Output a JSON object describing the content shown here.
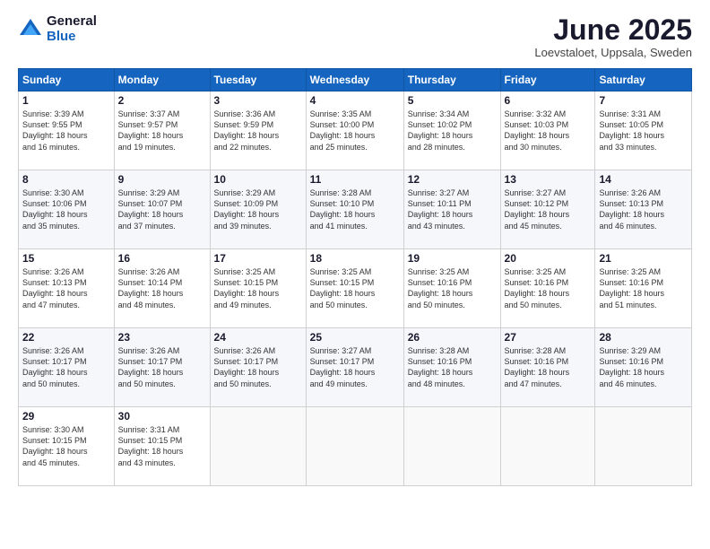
{
  "logo": {
    "general": "General",
    "blue": "Blue"
  },
  "header": {
    "title": "June 2025",
    "subtitle": "Loevstaloet, Uppsala, Sweden"
  },
  "weekdays": [
    "Sunday",
    "Monday",
    "Tuesday",
    "Wednesday",
    "Thursday",
    "Friday",
    "Saturday"
  ],
  "weeks": [
    [
      {
        "day": "1",
        "sunrise": "3:39 AM",
        "sunset": "9:55 PM",
        "daylight": "18 hours and 16 minutes."
      },
      {
        "day": "2",
        "sunrise": "3:37 AM",
        "sunset": "9:57 PM",
        "daylight": "18 hours and 19 minutes."
      },
      {
        "day": "3",
        "sunrise": "3:36 AM",
        "sunset": "9:59 PM",
        "daylight": "18 hours and 22 minutes."
      },
      {
        "day": "4",
        "sunrise": "3:35 AM",
        "sunset": "10:00 PM",
        "daylight": "18 hours and 25 minutes."
      },
      {
        "day": "5",
        "sunrise": "3:34 AM",
        "sunset": "10:02 PM",
        "daylight": "18 hours and 28 minutes."
      },
      {
        "day": "6",
        "sunrise": "3:32 AM",
        "sunset": "10:03 PM",
        "daylight": "18 hours and 30 minutes."
      },
      {
        "day": "7",
        "sunrise": "3:31 AM",
        "sunset": "10:05 PM",
        "daylight": "18 hours and 33 minutes."
      }
    ],
    [
      {
        "day": "8",
        "sunrise": "3:30 AM",
        "sunset": "10:06 PM",
        "daylight": "18 hours and 35 minutes."
      },
      {
        "day": "9",
        "sunrise": "3:29 AM",
        "sunset": "10:07 PM",
        "daylight": "18 hours and 37 minutes."
      },
      {
        "day": "10",
        "sunrise": "3:29 AM",
        "sunset": "10:09 PM",
        "daylight": "18 hours and 39 minutes."
      },
      {
        "day": "11",
        "sunrise": "3:28 AM",
        "sunset": "10:10 PM",
        "daylight": "18 hours and 41 minutes."
      },
      {
        "day": "12",
        "sunrise": "3:27 AM",
        "sunset": "10:11 PM",
        "daylight": "18 hours and 43 minutes."
      },
      {
        "day": "13",
        "sunrise": "3:27 AM",
        "sunset": "10:12 PM",
        "daylight": "18 hours and 45 minutes."
      },
      {
        "day": "14",
        "sunrise": "3:26 AM",
        "sunset": "10:13 PM",
        "daylight": "18 hours and 46 minutes."
      }
    ],
    [
      {
        "day": "15",
        "sunrise": "3:26 AM",
        "sunset": "10:13 PM",
        "daylight": "18 hours and 47 minutes."
      },
      {
        "day": "16",
        "sunrise": "3:26 AM",
        "sunset": "10:14 PM",
        "daylight": "18 hours and 48 minutes."
      },
      {
        "day": "17",
        "sunrise": "3:25 AM",
        "sunset": "10:15 PM",
        "daylight": "18 hours and 49 minutes."
      },
      {
        "day": "18",
        "sunrise": "3:25 AM",
        "sunset": "10:15 PM",
        "daylight": "18 hours and 50 minutes."
      },
      {
        "day": "19",
        "sunrise": "3:25 AM",
        "sunset": "10:16 PM",
        "daylight": "18 hours and 50 minutes."
      },
      {
        "day": "20",
        "sunrise": "3:25 AM",
        "sunset": "10:16 PM",
        "daylight": "18 hours and 50 minutes."
      },
      {
        "day": "21",
        "sunrise": "3:25 AM",
        "sunset": "10:16 PM",
        "daylight": "18 hours and 51 minutes."
      }
    ],
    [
      {
        "day": "22",
        "sunrise": "3:26 AM",
        "sunset": "10:17 PM",
        "daylight": "18 hours and 50 minutes."
      },
      {
        "day": "23",
        "sunrise": "3:26 AM",
        "sunset": "10:17 PM",
        "daylight": "18 hours and 50 minutes."
      },
      {
        "day": "24",
        "sunrise": "3:26 AM",
        "sunset": "10:17 PM",
        "daylight": "18 hours and 50 minutes."
      },
      {
        "day": "25",
        "sunrise": "3:27 AM",
        "sunset": "10:17 PM",
        "daylight": "18 hours and 49 minutes."
      },
      {
        "day": "26",
        "sunrise": "3:28 AM",
        "sunset": "10:16 PM",
        "daylight": "18 hours and 48 minutes."
      },
      {
        "day": "27",
        "sunrise": "3:28 AM",
        "sunset": "10:16 PM",
        "daylight": "18 hours and 47 minutes."
      },
      {
        "day": "28",
        "sunrise": "3:29 AM",
        "sunset": "10:16 PM",
        "daylight": "18 hours and 46 minutes."
      }
    ],
    [
      {
        "day": "29",
        "sunrise": "3:30 AM",
        "sunset": "10:15 PM",
        "daylight": "18 hours and 45 minutes."
      },
      {
        "day": "30",
        "sunrise": "3:31 AM",
        "sunset": "10:15 PM",
        "daylight": "18 hours and 43 minutes."
      },
      null,
      null,
      null,
      null,
      null
    ]
  ]
}
